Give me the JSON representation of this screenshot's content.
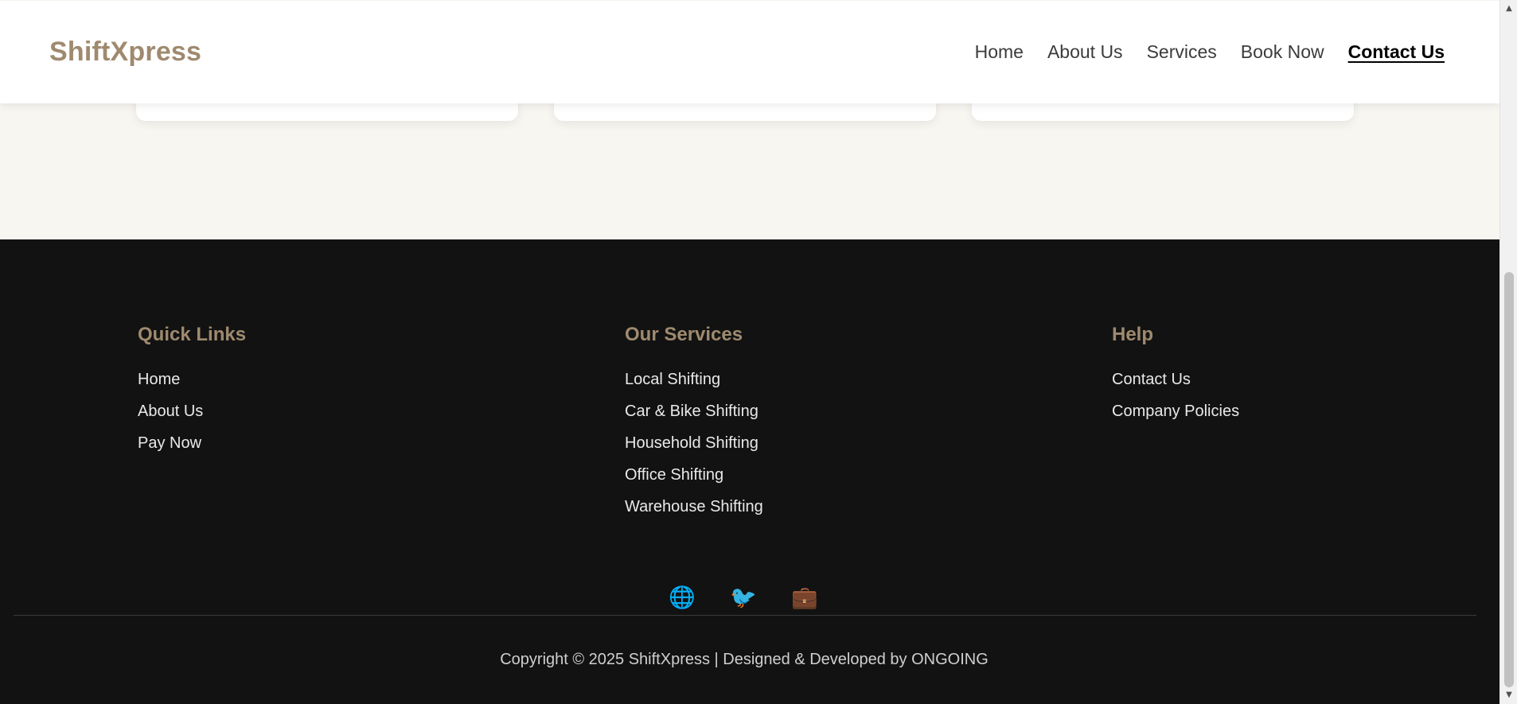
{
  "header": {
    "brand": "ShiftXpress",
    "nav": [
      {
        "label": "Home",
        "active": false
      },
      {
        "label": "About Us",
        "active": false
      },
      {
        "label": "Services",
        "active": false
      },
      {
        "label": "Book Now",
        "active": false
      },
      {
        "label": "Contact Us",
        "active": true
      }
    ]
  },
  "footer": {
    "columns": [
      {
        "title": "Quick Links",
        "links": [
          "Home",
          "About Us",
          "Pay Now"
        ]
      },
      {
        "title": "Our Services",
        "links": [
          "Local Shifting",
          "Car & Bike Shifting",
          "Household Shifting",
          "Office Shifting",
          "Warehouse Shifting"
        ]
      },
      {
        "title": "Help",
        "links": [
          "Contact Us",
          "Company Policies"
        ]
      }
    ],
    "socials": [
      {
        "icon": "globe-icon",
        "glyph": "🌐"
      },
      {
        "icon": "bird-icon",
        "glyph": "🐦"
      },
      {
        "icon": "briefcase-icon",
        "glyph": "💼"
      }
    ],
    "copyright": "Copyright © 2025 ShiftXpress | Designed & Developed by ONGOING"
  },
  "scrollbar": {
    "up_arrow": "▲",
    "down_arrow": "▼"
  },
  "colors": {
    "brand": "#9f8a6f",
    "footer_bg": "#121212",
    "page_bg": "#f8f6f1",
    "link_text": "#e9e9e9"
  }
}
